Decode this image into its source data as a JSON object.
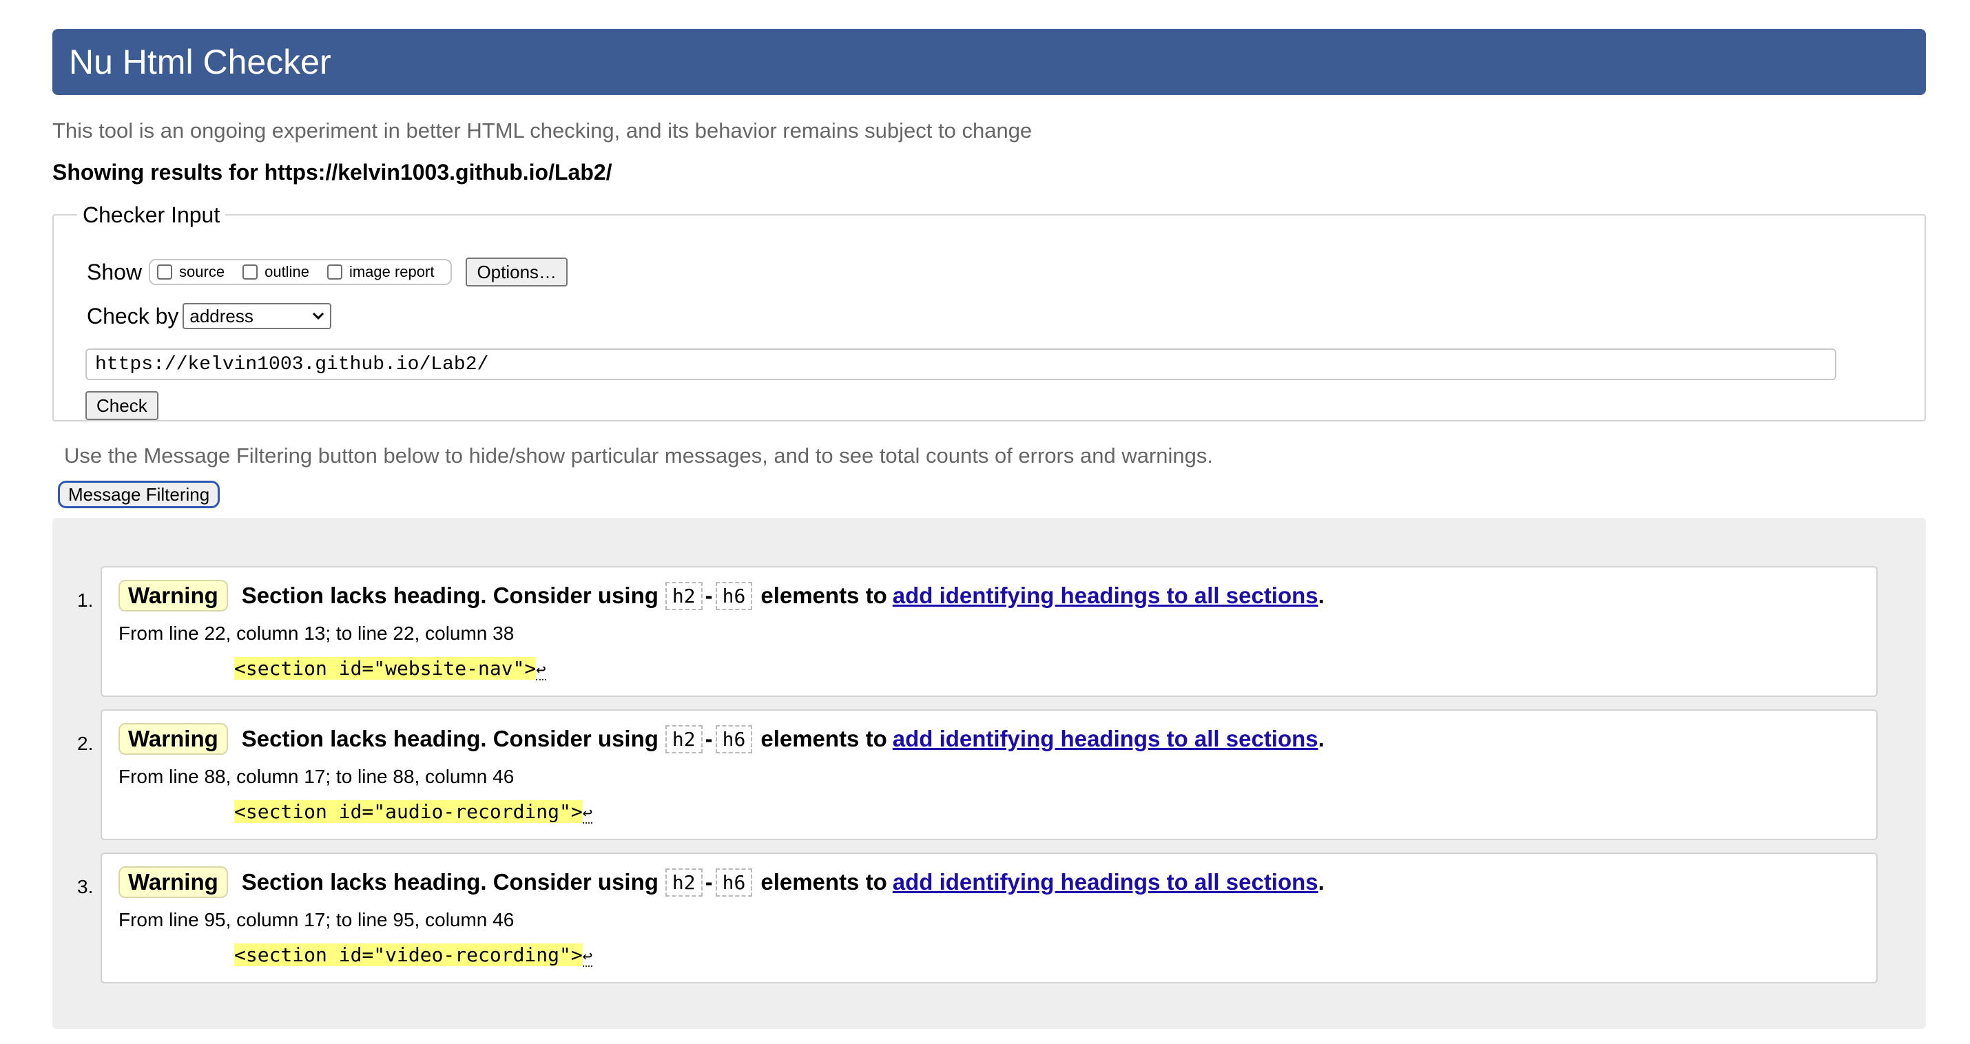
{
  "header": {
    "title": "Nu Html Checker"
  },
  "tagline": "This tool is an ongoing experiment in better HTML checking, and its behavior remains subject to change",
  "showing": "Showing results for https://kelvin1003.github.io/Lab2/",
  "checker_input": {
    "legend": "Checker Input",
    "show_label": "Show",
    "options": [
      "source",
      "outline",
      "image report"
    ],
    "options_button": "Options…",
    "check_by_label": "Check by",
    "check_by_value": "address",
    "url_value": "https://kelvin1003.github.io/Lab2/",
    "check_button": "Check"
  },
  "filter_note": "Use the Message Filtering button below to hide/show particular messages, and to see total counts of errors and warnings.",
  "filter_button": "Message Filtering",
  "messages": [
    {
      "num": "1.",
      "type": "Warning",
      "text_before": "Section lacks heading. Consider using",
      "chip1": "h2",
      "dash": "-",
      "chip2": "h6",
      "text_after": "elements to",
      "link": "add identifying headings to all sections",
      "period": ".",
      "location": "From line 22, column 13; to line 22, column 38",
      "code": "<section id=\"website-nav\">",
      "ret": "↩"
    },
    {
      "num": "2.",
      "type": "Warning",
      "text_before": "Section lacks heading. Consider using",
      "chip1": "h2",
      "dash": "-",
      "chip2": "h6",
      "text_after": "elements to",
      "link": "add identifying headings to all sections",
      "period": ".",
      "location": "From line 88, column 17; to line 88, column 46",
      "code": "<section id=\"audio-recording\">",
      "ret": "↩"
    },
    {
      "num": "3.",
      "type": "Warning",
      "text_before": "Section lacks heading. Consider using",
      "chip1": "h2",
      "dash": "-",
      "chip2": "h6",
      "text_after": "elements to",
      "link": "add identifying headings to all sections",
      "period": ".",
      "location": "From line 95, column 17; to line 95, column 46",
      "code": "<section id=\"video-recording\">",
      "ret": "↩"
    }
  ],
  "colors": {
    "header": "#3c5c93",
    "warning_badge": "#ffffcc",
    "code_highlight": "#ffff80",
    "link": "#1a0dab"
  }
}
